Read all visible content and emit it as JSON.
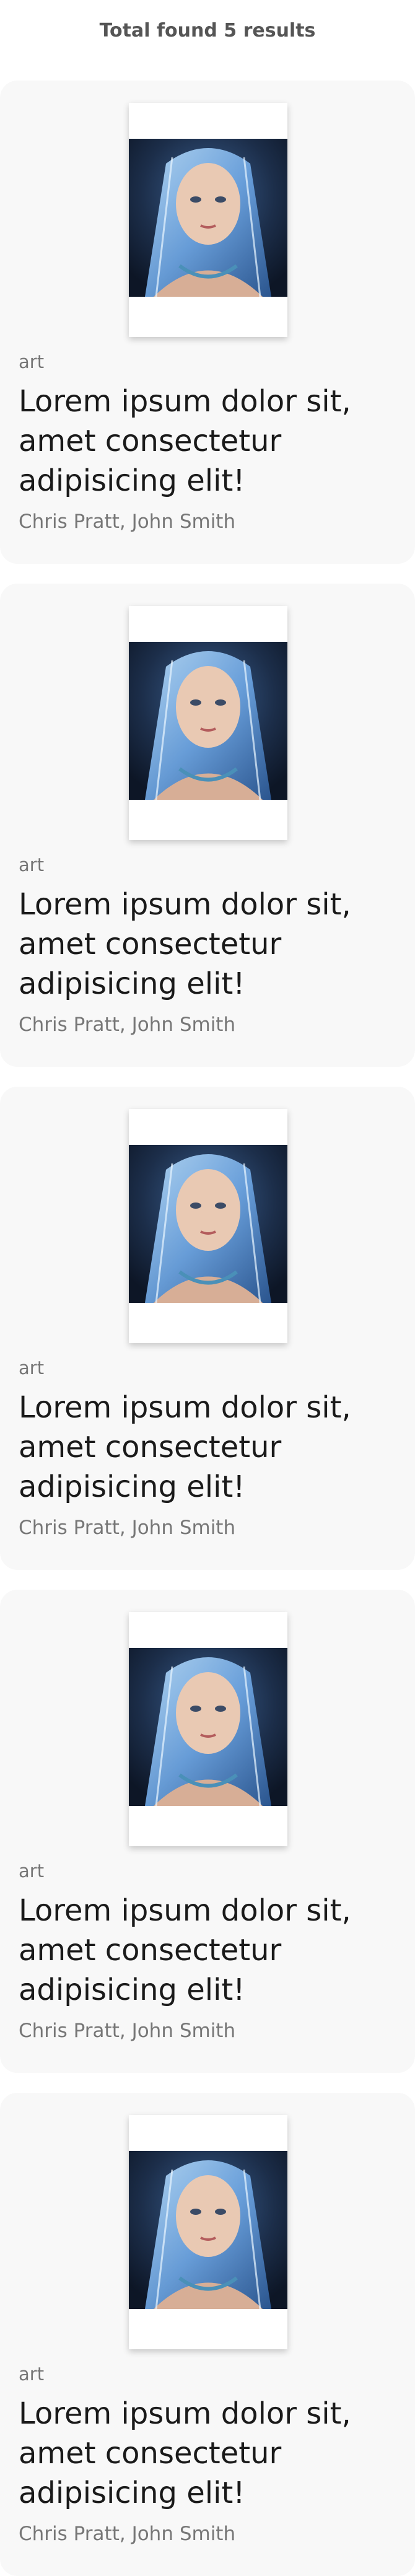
{
  "results_summary": "Total found 5 results",
  "books": [
    {
      "category": "art",
      "title": "Lorem ipsum dolor sit, amet consectetur adipisicing elit!",
      "authors": "Chris Pratt, John Smith"
    },
    {
      "category": "art",
      "title": "Lorem ipsum dolor sit, amet consectetur adipisicing elit!",
      "authors": "Chris Pratt, John Smith"
    },
    {
      "category": "art",
      "title": "Lorem ipsum dolor sit, amet consectetur adipisicing elit!",
      "authors": "Chris Pratt, John Smith"
    },
    {
      "category": "art",
      "title": "Lorem ipsum dolor sit, amet consectetur adipisicing elit!",
      "authors": "Chris Pratt, John Smith"
    },
    {
      "category": "art",
      "title": "Lorem ipsum dolor sit, amet consectetur adipisicing elit!",
      "authors": "Chris Pratt, John Smith"
    }
  ]
}
